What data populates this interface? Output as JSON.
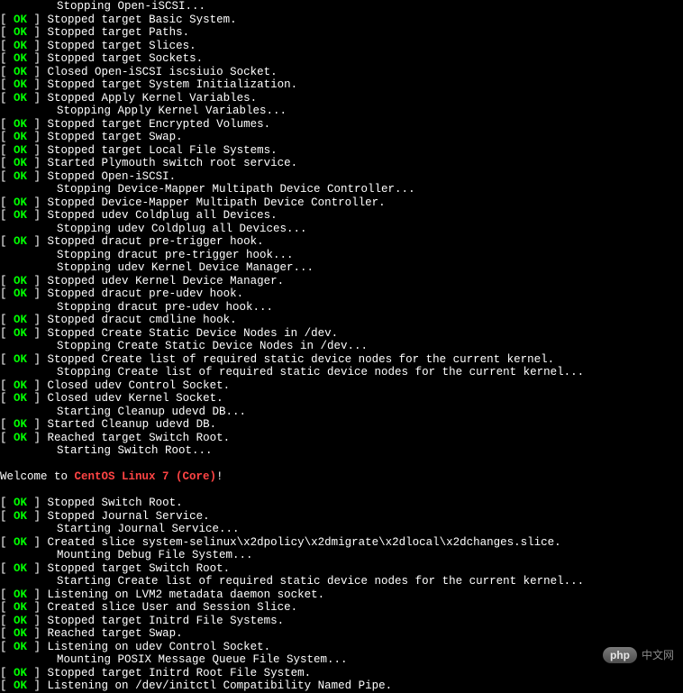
{
  "ok_label": "OK",
  "lines": [
    {
      "type": "indent",
      "text": "Stopping Open-iSCSI..."
    },
    {
      "type": "ok",
      "text": "Stopped target Basic System."
    },
    {
      "type": "ok",
      "text": "Stopped target Paths."
    },
    {
      "type": "ok",
      "text": "Stopped target Slices."
    },
    {
      "type": "ok",
      "text": "Stopped target Sockets."
    },
    {
      "type": "ok",
      "text": "Closed Open-iSCSI iscsiuio Socket."
    },
    {
      "type": "ok",
      "text": "Stopped target System Initialization."
    },
    {
      "type": "ok",
      "text": "Stopped Apply Kernel Variables."
    },
    {
      "type": "indent",
      "text": "Stopping Apply Kernel Variables..."
    },
    {
      "type": "ok",
      "text": "Stopped target Encrypted Volumes."
    },
    {
      "type": "ok",
      "text": "Stopped target Swap."
    },
    {
      "type": "ok",
      "text": "Stopped target Local File Systems."
    },
    {
      "type": "ok",
      "text": "Started Plymouth switch root service."
    },
    {
      "type": "ok",
      "text": "Stopped Open-iSCSI."
    },
    {
      "type": "indent",
      "text": "Stopping Device-Mapper Multipath Device Controller..."
    },
    {
      "type": "ok",
      "text": "Stopped Device-Mapper Multipath Device Controller."
    },
    {
      "type": "ok",
      "text": "Stopped udev Coldplug all Devices."
    },
    {
      "type": "indent",
      "text": "Stopping udev Coldplug all Devices..."
    },
    {
      "type": "ok",
      "text": "Stopped dracut pre-trigger hook."
    },
    {
      "type": "indent",
      "text": "Stopping dracut pre-trigger hook..."
    },
    {
      "type": "indent",
      "text": "Stopping udev Kernel Device Manager..."
    },
    {
      "type": "ok",
      "text": "Stopped udev Kernel Device Manager."
    },
    {
      "type": "ok",
      "text": "Stopped dracut pre-udev hook."
    },
    {
      "type": "indent",
      "text": "Stopping dracut pre-udev hook..."
    },
    {
      "type": "ok",
      "text": "Stopped dracut cmdline hook."
    },
    {
      "type": "ok",
      "text": "Stopped Create Static Device Nodes in /dev."
    },
    {
      "type": "indent",
      "text": "Stopping Create Static Device Nodes in /dev..."
    },
    {
      "type": "ok",
      "text": "Stopped Create list of required static device nodes for the current kernel."
    },
    {
      "type": "indent",
      "text": "Stopping Create list of required static device nodes for the current kernel..."
    },
    {
      "type": "ok",
      "text": "Closed udev Control Socket."
    },
    {
      "type": "ok",
      "text": "Closed udev Kernel Socket."
    },
    {
      "type": "indent",
      "text": "Starting Cleanup udevd DB..."
    },
    {
      "type": "ok",
      "text": "Started Cleanup udevd DB."
    },
    {
      "type": "ok",
      "text": "Reached target Switch Root."
    },
    {
      "type": "indent",
      "text": "Starting Switch Root..."
    },
    {
      "type": "blank"
    },
    {
      "type": "welcome"
    },
    {
      "type": "blank"
    },
    {
      "type": "ok",
      "text": "Stopped Switch Root."
    },
    {
      "type": "ok",
      "text": "Stopped Journal Service."
    },
    {
      "type": "indent",
      "text": "Starting Journal Service..."
    },
    {
      "type": "ok",
      "text": "Created slice system-selinux\\x2dpolicy\\x2dmigrate\\x2dlocal\\x2dchanges.slice."
    },
    {
      "type": "indent",
      "text": "Mounting Debug File System..."
    },
    {
      "type": "ok",
      "text": "Stopped target Switch Root."
    },
    {
      "type": "indent",
      "text": "Starting Create list of required static device nodes for the current kernel..."
    },
    {
      "type": "ok",
      "text": "Listening on LVM2 metadata daemon socket."
    },
    {
      "type": "ok",
      "text": "Created slice User and Session Slice."
    },
    {
      "type": "ok",
      "text": "Stopped target Initrd File Systems."
    },
    {
      "type": "ok",
      "text": "Reached target Swap."
    },
    {
      "type": "ok",
      "text": "Listening on udev Control Socket."
    },
    {
      "type": "indent",
      "text": "Mounting POSIX Message Queue File System..."
    },
    {
      "type": "ok",
      "text": "Stopped target Initrd Root File System."
    },
    {
      "type": "ok",
      "text": "Listening on /dev/initctl Compatibility Named Pipe."
    }
  ],
  "welcome": {
    "prefix": "Welcome to ",
    "distro": "CentOS Linux 7 (Core)",
    "suffix": "!"
  },
  "watermark": {
    "badge": "php",
    "text": "中文网"
  }
}
